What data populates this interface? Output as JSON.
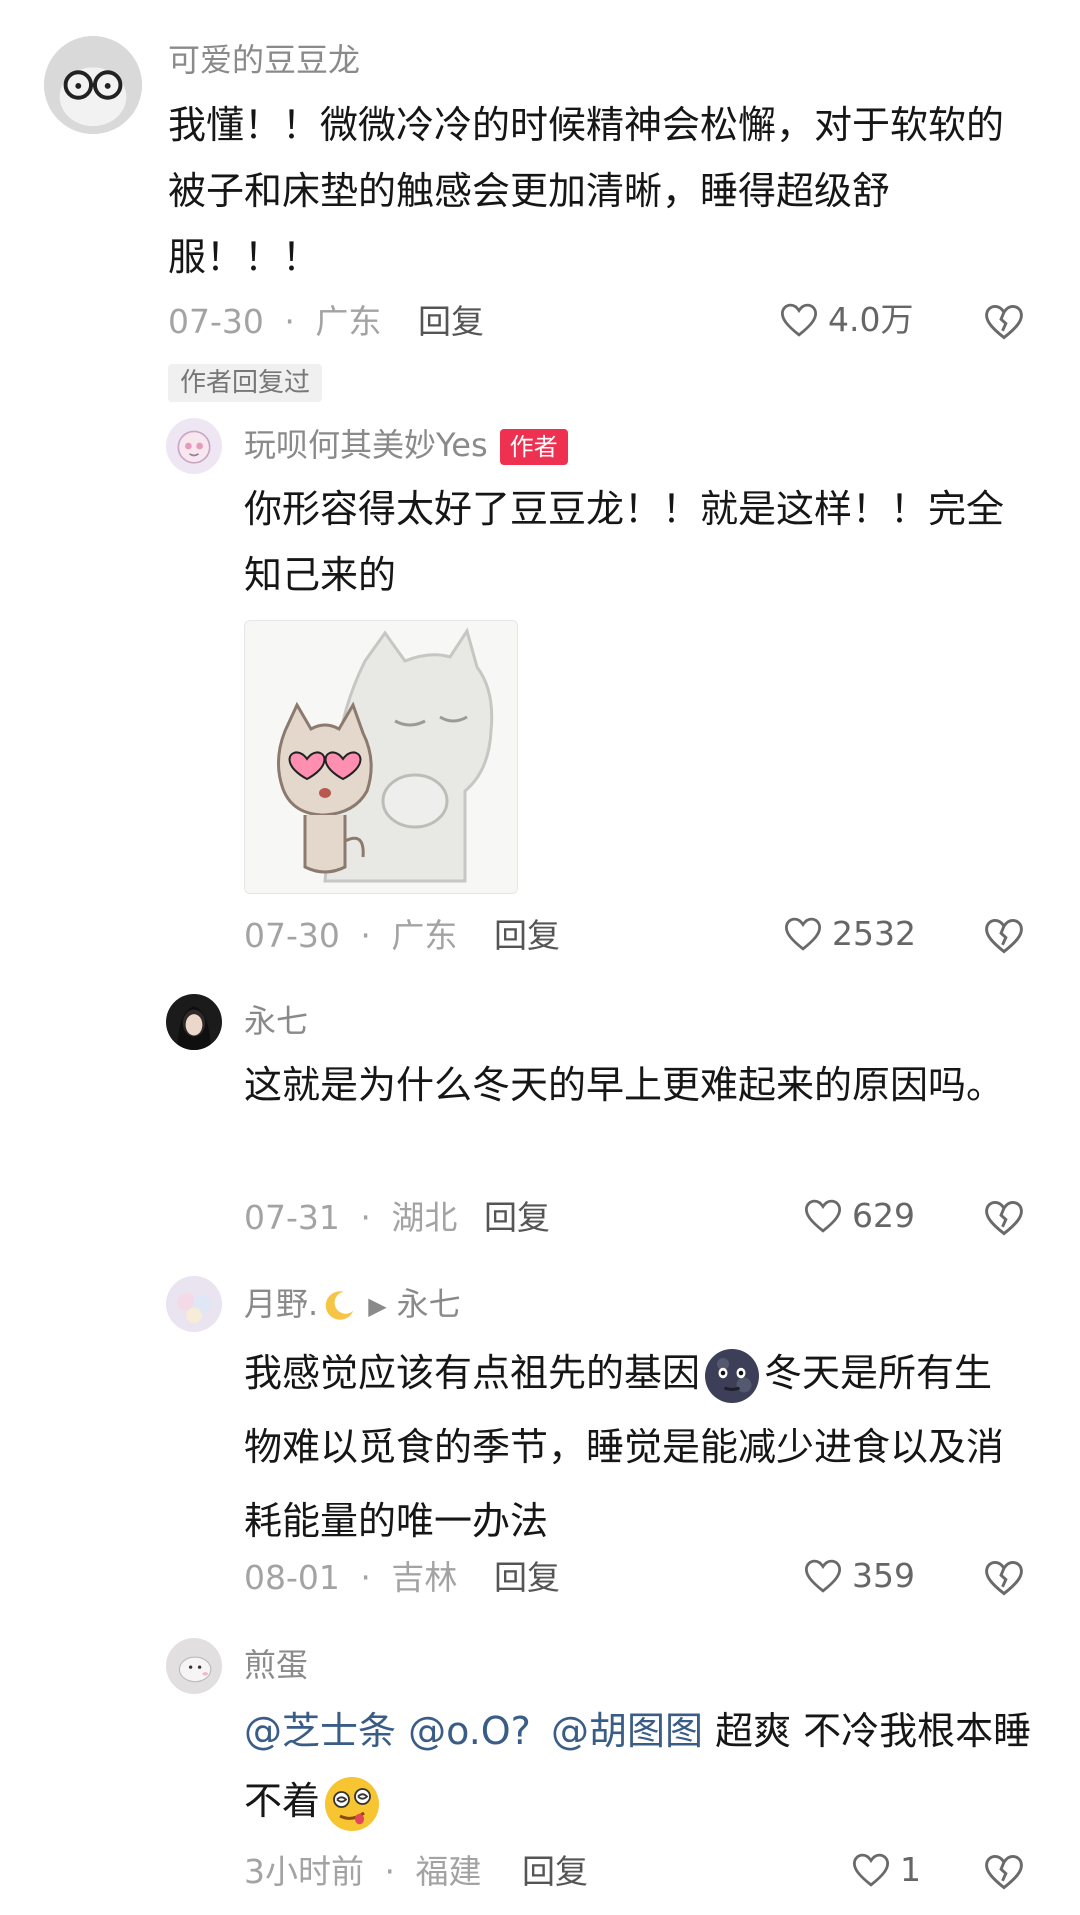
{
  "comments": [
    {
      "user": "可爱的豆豆龙",
      "text": "我懂！！微微冷冷的时候精神会松懈，对于软软的被子和床垫的触感会更加清晰，睡得超级舒服！！！",
      "date": "07-30",
      "location": "广东",
      "reply_label": "回复",
      "likes": "4.0万",
      "author_replied_tag": "作者回复过"
    },
    {
      "user": "玩呗何其美妙Yes",
      "badge": "作者",
      "text": "你形容得太好了豆豆龙！！就是这样！！完全知己来的",
      "date": "07-30",
      "location": "广东",
      "reply_label": "回复",
      "likes": "2532",
      "sticker": "cat-sticker"
    },
    {
      "user": "永七",
      "text": "这就是为什么冬天的早上更难起来的原因吗。",
      "date": "07-31",
      "location": "湖北",
      "reply_label": "回复",
      "likes": "629"
    },
    {
      "user": "月野.",
      "reply_to": "永七",
      "text_before_emoji": "我感觉应该有点祖先的基因",
      "text_after_emoji": "冬天是所有生物难以觅食的季节，睡觉是能减少进食以及消耗能量的唯一办法",
      "date": "08-01",
      "location": "吉林",
      "reply_label": "回复",
      "likes": "359"
    },
    {
      "user": "煎蛋",
      "mentions": [
        "@芝士条",
        "@o.O?",
        "@胡图图"
      ],
      "text": "超爽 不冷我根本睡不着",
      "date": "3小时前",
      "location": "福建",
      "reply_label": "回复",
      "likes": "1"
    }
  ],
  "meta_separator": "·",
  "icons": {
    "like": "heart-outline-icon",
    "dislike": "broken-heart-icon",
    "moon_emoji": "new-moon-face-emoji",
    "crazy_emoji": "woozy-face-emoji",
    "crescent": "crescent-moon-emoji"
  },
  "colors": {
    "author_badge": "#ee3150",
    "mention": "#3a5d87"
  }
}
